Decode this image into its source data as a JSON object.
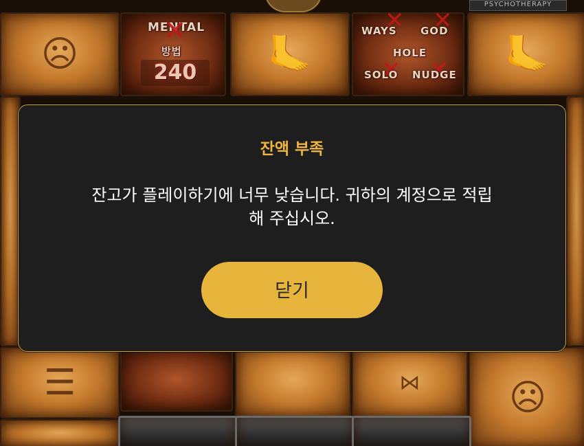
{
  "game": {
    "top_banner_label": "PSYCHOTHERAPY",
    "mental_feature_title": "MENTAL",
    "mental_feature_sub": "방법",
    "mental_feature_count": "240",
    "feature_labels": [
      "WAYS",
      "GOD",
      "HOLE",
      "SOLO",
      "NUDGE"
    ]
  },
  "dialog": {
    "title": "잔액 부족",
    "message_line1": "잔고가 플레이하기에 너무 낮습니다. 귀하의 계정으로 적립",
    "message_line2": "해 주십시오.",
    "close_label": "닫기"
  },
  "colors": {
    "dialog_bg": "#1e1e1e",
    "dialog_border": "#c9a24a",
    "title_color": "#f0b441",
    "button_color": "#e8b53c"
  }
}
